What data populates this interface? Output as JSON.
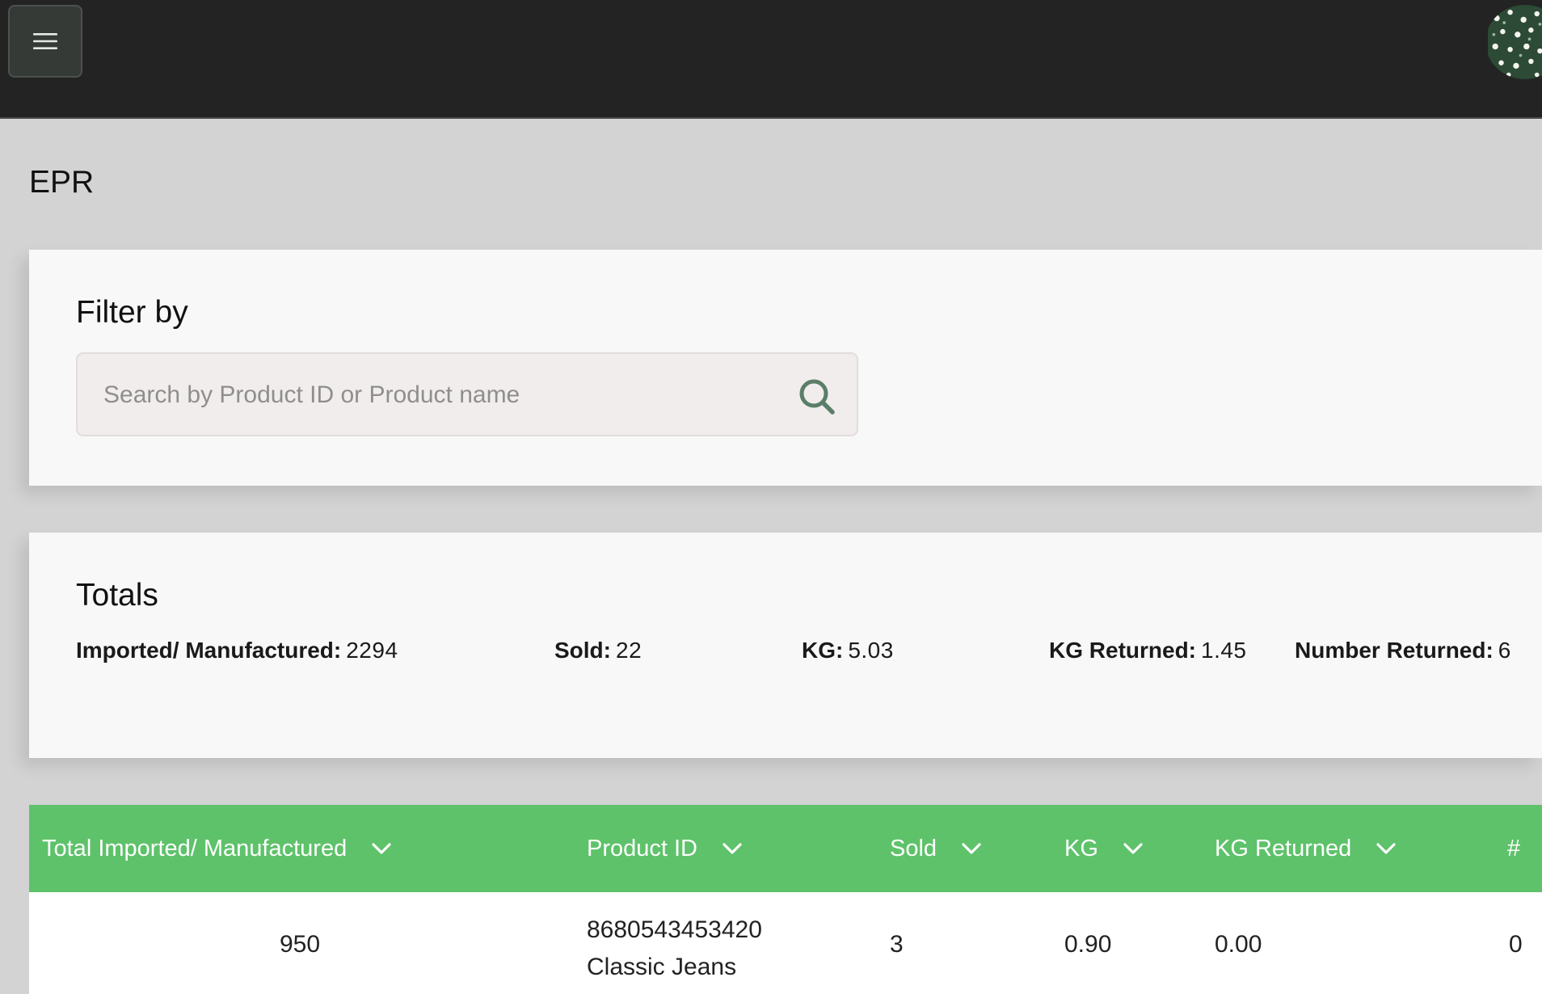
{
  "page": {
    "title": "EPR"
  },
  "icons": {
    "menu": "hamburger-menu-icon",
    "search": "search-icon",
    "sort": "chevron-down-icon",
    "avatar": "user-avatar"
  },
  "colors": {
    "topbar": "#232323",
    "accent_green": "#5ec26a",
    "search_icon": "#5b7e68"
  },
  "filter": {
    "heading": "Filter by",
    "search_placeholder": "Search by Product ID or Product name",
    "search_value": ""
  },
  "totals": {
    "heading": "Totals",
    "items": [
      {
        "label": "Imported/ Manufactured:",
        "value": "2294"
      },
      {
        "label": "Sold:",
        "value": "22"
      },
      {
        "label": "KG:",
        "value": "5.03"
      },
      {
        "label": "KG Returned:",
        "value": "1.45"
      },
      {
        "label": "Number Returned:",
        "value": "6"
      }
    ]
  },
  "table": {
    "columns": [
      {
        "label": "Total Imported/ Manufactured"
      },
      {
        "label": "Product ID"
      },
      {
        "label": "Sold"
      },
      {
        "label": "KG"
      },
      {
        "label": "KG Returned"
      },
      {
        "label": "#"
      }
    ],
    "rows": [
      {
        "total_imported": "950",
        "product_id": "8680543453420",
        "product_name": "Classic Jeans",
        "sold": "3",
        "kg": "0.90",
        "kg_returned": "0.00",
        "number_returned": "0"
      }
    ]
  }
}
